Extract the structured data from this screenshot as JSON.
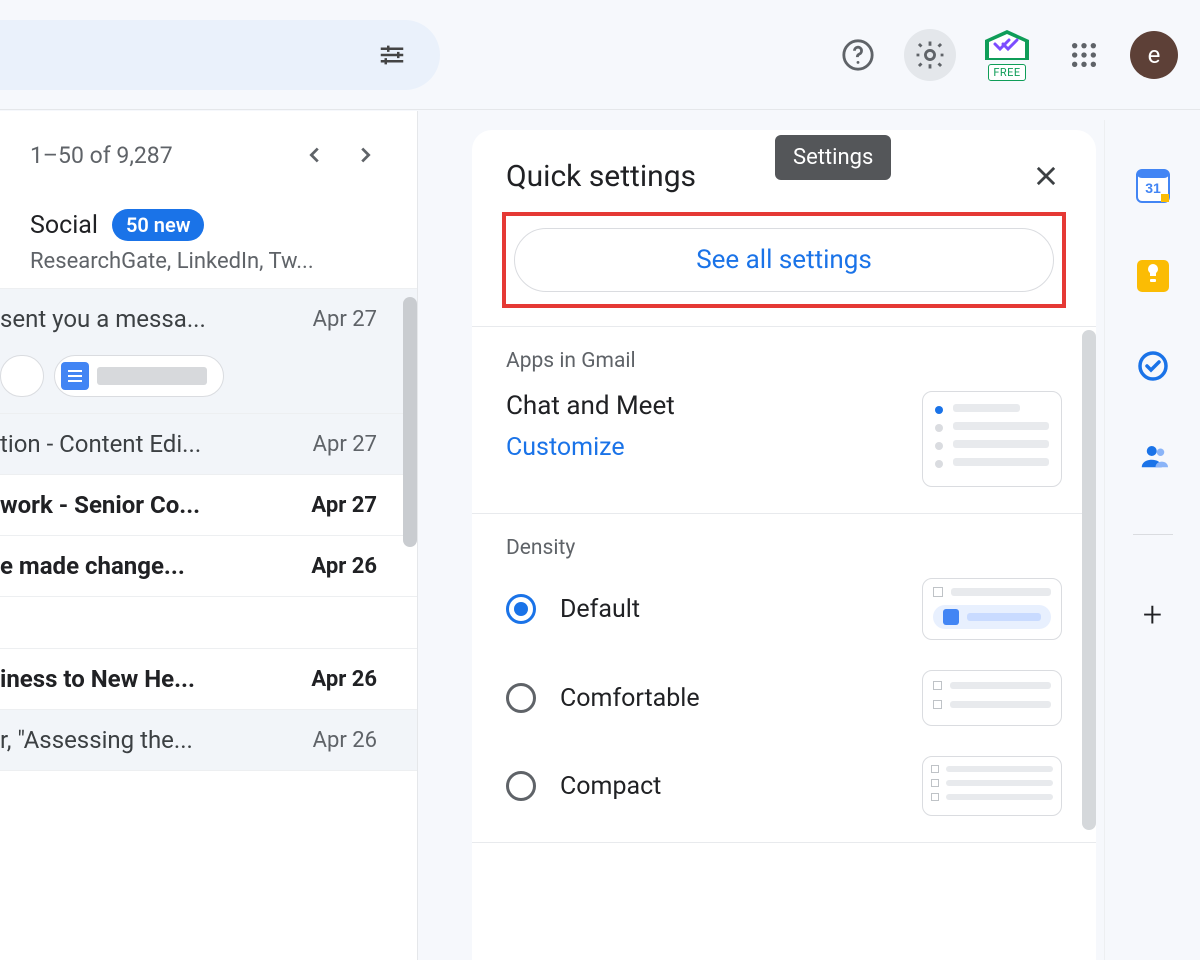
{
  "top": {
    "tooltip": "Settings",
    "mailtrack_label": "FREE",
    "avatar_letter": "e"
  },
  "inbox": {
    "pager_text": "1–50 of 9,287",
    "social": {
      "title": "Social",
      "badge": "50 new",
      "subtitle": "ResearchGate, LinkedIn, Tw..."
    },
    "messages": [
      {
        "subject": "sent you a messa...",
        "date": "Apr 27",
        "unread": false,
        "chip": true
      },
      {
        "subject": "tion - Content Edi...",
        "date": "Apr 27",
        "unread": false
      },
      {
        "subject": "work - Senior Co...",
        "date": "Apr 27",
        "unread": true
      },
      {
        "subject": "e made change...",
        "date": "Apr 26",
        "unread": true
      },
      {
        "subject": "iness to New He...",
        "date": "Apr 26",
        "unread": true
      },
      {
        "subject": "r, \"Assessing the...",
        "date": "Apr 26",
        "unread": false
      }
    ]
  },
  "panel": {
    "title": "Quick settings",
    "see_all": "See all settings",
    "apps_section": "Apps in Gmail",
    "chat_meet": "Chat and Meet",
    "customize": "Customize",
    "density_section": "Density",
    "density": {
      "default": "Default",
      "comfortable": "Comfortable",
      "compact": "Compact"
    }
  },
  "rail": {
    "calendar_day": "31"
  }
}
